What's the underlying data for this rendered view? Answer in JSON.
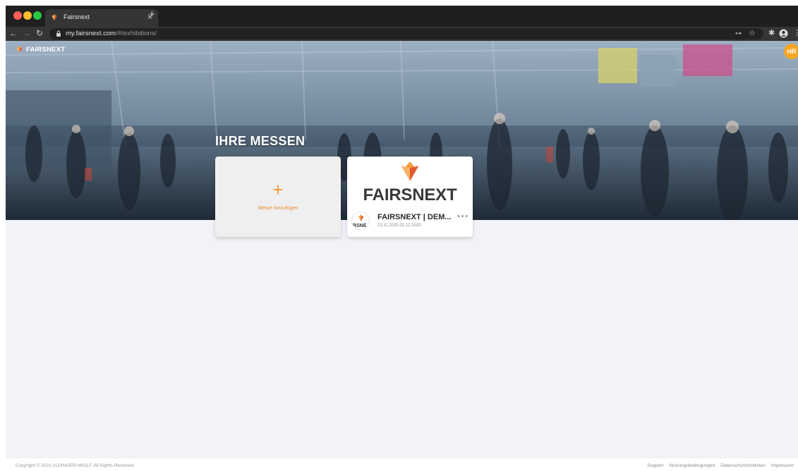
{
  "browser": {
    "tab_title": "Fairsnext",
    "tab_close": "×",
    "new_tab": "+",
    "url_host": "my.fairsnext.com",
    "url_path": "/#/exhibitions/"
  },
  "app": {
    "logo_text": "FAIRSNEXT",
    "avatar_initials": "HR",
    "heading": "IHRE MESSEN"
  },
  "add_card": {
    "plus": "+",
    "label": "Messe hinzufügen"
  },
  "exhibitions": [
    {
      "brand_name": "FAIRSNEXT",
      "thumb_text": "IRSNE",
      "name": "FAIRSNEXT | DEM...",
      "dates": "23.11.2020-31.12.2020",
      "more": "···"
    }
  ],
  "footer": {
    "copyright": "Copyright © 2021 ALDINGER+WOLF. All Rights Reserved.",
    "links": [
      "Support",
      "Nutzungsbedingungen",
      "Datenschutzrichtlinien",
      "Impressum"
    ]
  },
  "colors": {
    "brand_orange": "#f39a3a",
    "brand_red": "#e4572e",
    "avatar": "#f5a623"
  }
}
